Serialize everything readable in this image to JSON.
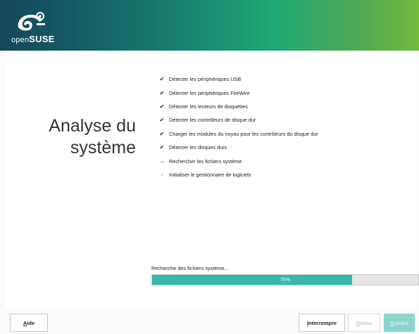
{
  "header": {
    "logo_open": "open",
    "logo_suse": "SUSE"
  },
  "step": {
    "title_line1": "Analyse du",
    "title_line2": "système"
  },
  "tasks": [
    {
      "label": "Détecter les périphériques USB",
      "status": "done",
      "mark": "✔"
    },
    {
      "label": "Détecter les périphériques FireWire",
      "status": "done",
      "mark": "✔"
    },
    {
      "label": "Détecter les lecteurs de disquettes",
      "status": "done",
      "mark": "✔"
    },
    {
      "label": "Détecter les contrôleurs de disque dur",
      "status": "done",
      "mark": "✔"
    },
    {
      "label": "Charger les modules du noyau pour les contrôleurs du disque dur",
      "status": "done",
      "mark": "✔"
    },
    {
      "label": "Détecter les disques durs",
      "status": "done",
      "mark": "✔"
    },
    {
      "label": "Rechercher les fichiers système",
      "status": "current",
      "mark": "→"
    },
    {
      "label": "Initialiser le gestionnaire de logiciels",
      "status": "pending",
      "mark": "-"
    }
  ],
  "progress": {
    "label": "Recherche des fichiers système...",
    "percent": 75,
    "text": "75%"
  },
  "buttons": {
    "help": {
      "mnemonic": "A",
      "rest": "ide"
    },
    "abort": {
      "mnemonic": "I",
      "rest": "nterrompre"
    },
    "back": {
      "mnemonic": "R",
      "rest": "etour",
      "enabled": false
    },
    "next": {
      "mnemonic": "S",
      "rest": "uivant",
      "enabled": false
    }
  },
  "colors": {
    "accent": "#35b9ab",
    "next_disabled": "#8bd6cc"
  }
}
